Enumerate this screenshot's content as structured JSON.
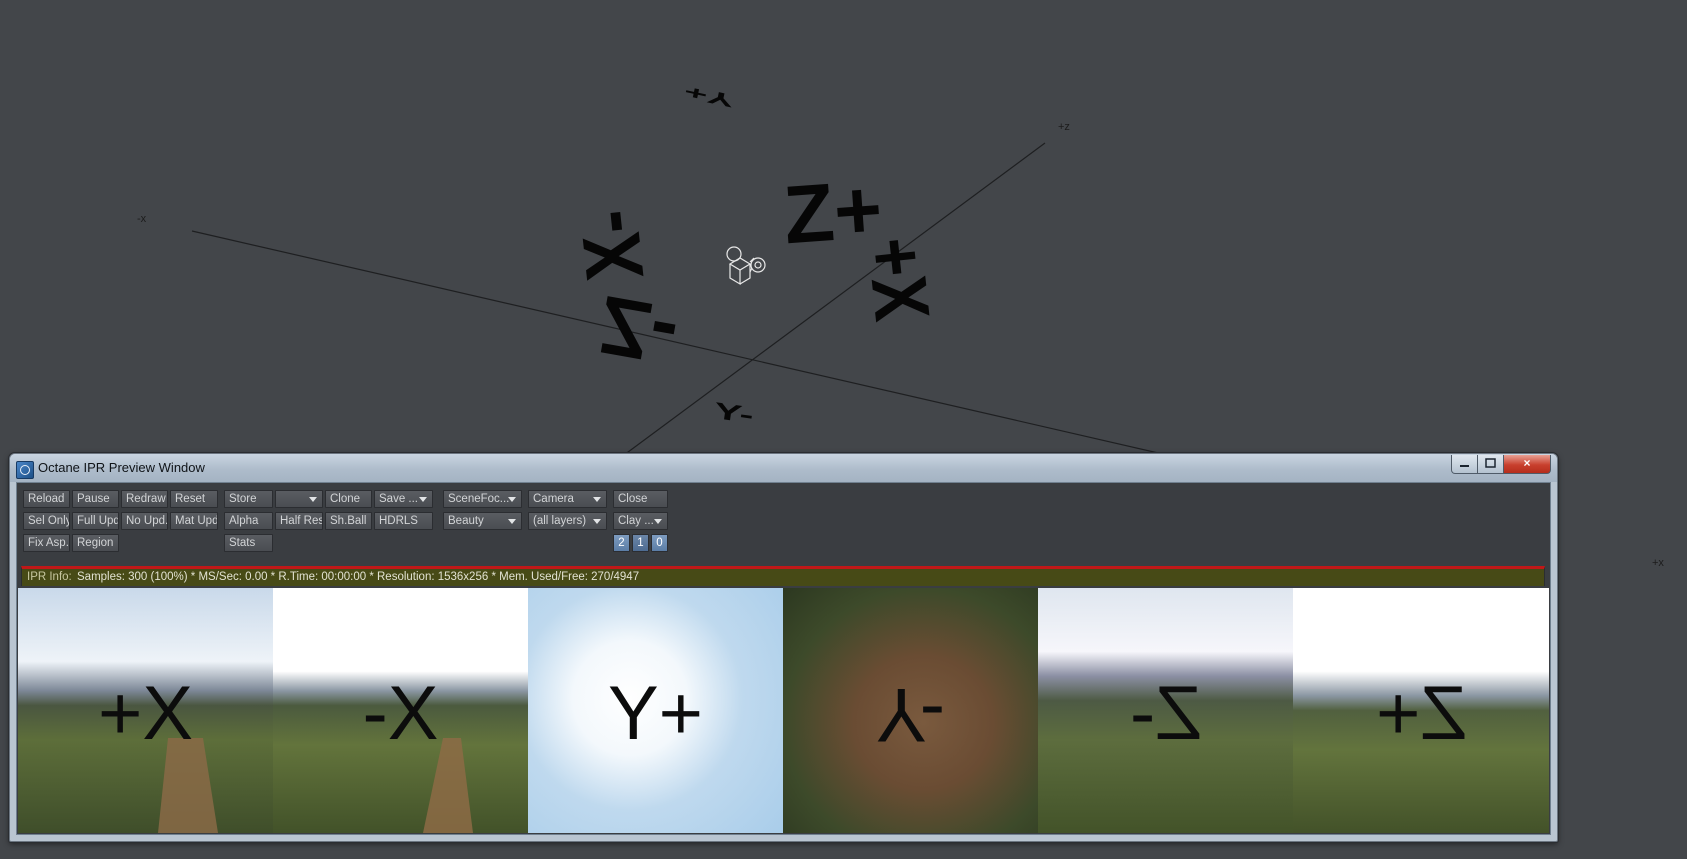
{
  "viewport": {
    "axis_labels": {
      "minus_x": "-x",
      "plus_z": "+z",
      "plus_x": "+x"
    },
    "glyphs": {
      "top_y": "Y+",
      "z_plus": "Z+",
      "x_minus": "X-",
      "x_plus": "X+",
      "z_minus": "Z-",
      "bottom_y": "Y-"
    },
    "camera_icon": "camera-icon"
  },
  "window": {
    "title": "Octane IPR Preview Window",
    "icon": "octane-app-icon",
    "controls": {
      "minimize": "minimize-icon",
      "maximize": "maximize-icon",
      "close": "×"
    }
  },
  "toolbar": {
    "reload": "Reload",
    "pause": "Pause",
    "redraw": "Redraw",
    "reset": "Reset",
    "sel_only": "Sel Only",
    "full_upd": "Full Upd.",
    "no_upd": "No Upd.",
    "mat_upd": "Mat Upd",
    "fix_asp": "Fix Asp.",
    "region": "Region",
    "store": "Store",
    "store_slot": "",
    "clone": "Clone",
    "save": "Save ...",
    "alpha": "Alpha",
    "half_res": "Half Res",
    "sh_ball": "Sh.Ball",
    "hdrls": "HDRLS",
    "stats": "Stats",
    "scene_focus": "SceneFoc...",
    "beauty": "Beauty",
    "camera": "Camera",
    "layers": "(all layers)",
    "close": "Close",
    "clay": "Clay ...",
    "pages": [
      "2",
      "1",
      "0"
    ]
  },
  "info": {
    "label": "IPR Info:",
    "text": "Samples: 300 (100%)  *  MS/Sec: 0.00  *  R.Time: 00:00:00  *  Resolution: 1536x256  *  Mem. Used/Free: 270/4947"
  },
  "render_tiles": [
    {
      "id": "px",
      "label": "+X",
      "scene": "sky-grass-path"
    },
    {
      "id": "nx",
      "label": "-X",
      "scene": "bright-sky-hills-path"
    },
    {
      "id": "py",
      "label": "Y+",
      "scene": "blue-sky-clouds"
    },
    {
      "id": "ny",
      "label": "Y-",
      "scene": "dirt-ground"
    },
    {
      "id": "nz",
      "label": "Z-",
      "scene": "cloudy-mountains-field"
    },
    {
      "id": "pz",
      "label": "Z+",
      "scene": "bright-sky-field-pond"
    }
  ],
  "colors": {
    "viewport_bg": "#43464a",
    "info_bar_bg": "#474a16",
    "info_bar_accent": "#c01818",
    "window_frame": "#b9c5d1"
  }
}
